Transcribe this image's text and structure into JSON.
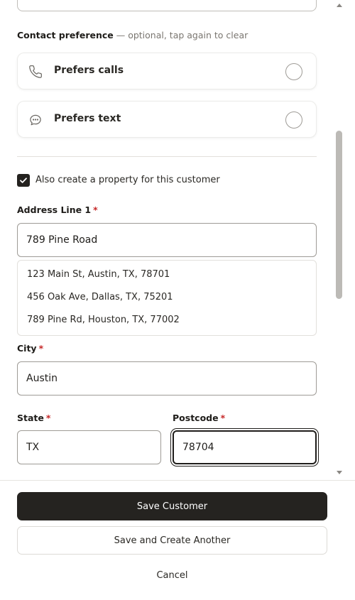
{
  "contact_preference": {
    "label": "Contact preference",
    "hint": " — optional, tap again to clear",
    "options": [
      {
        "label": "Prefers calls",
        "icon": "phone-icon",
        "selected": false
      },
      {
        "label": "Prefers text",
        "icon": "chat-icon",
        "selected": false
      }
    ]
  },
  "create_property": {
    "label": "Also create a property for this customer",
    "checked": true
  },
  "address": {
    "label": "Address Line 1",
    "required_mark": "*",
    "value": "789 Pine Road",
    "suggestions": [
      "123 Main St, Austin, TX, 78701",
      "456 Oak Ave, Dallas, TX, 75201",
      "789 Pine Rd, Houston, TX, 77002"
    ]
  },
  "city": {
    "label": "City",
    "required_mark": "*",
    "value": "Austin"
  },
  "state": {
    "label": "State",
    "required_mark": "*",
    "value": "TX"
  },
  "postcode": {
    "label": "Postcode",
    "required_mark": "*",
    "value": "78704"
  },
  "actions": {
    "save": "Save Customer",
    "save_another": "Save and Create Another",
    "cancel": "Cancel"
  },
  "colors": {
    "primary": "#252320",
    "required": "#c62828"
  }
}
